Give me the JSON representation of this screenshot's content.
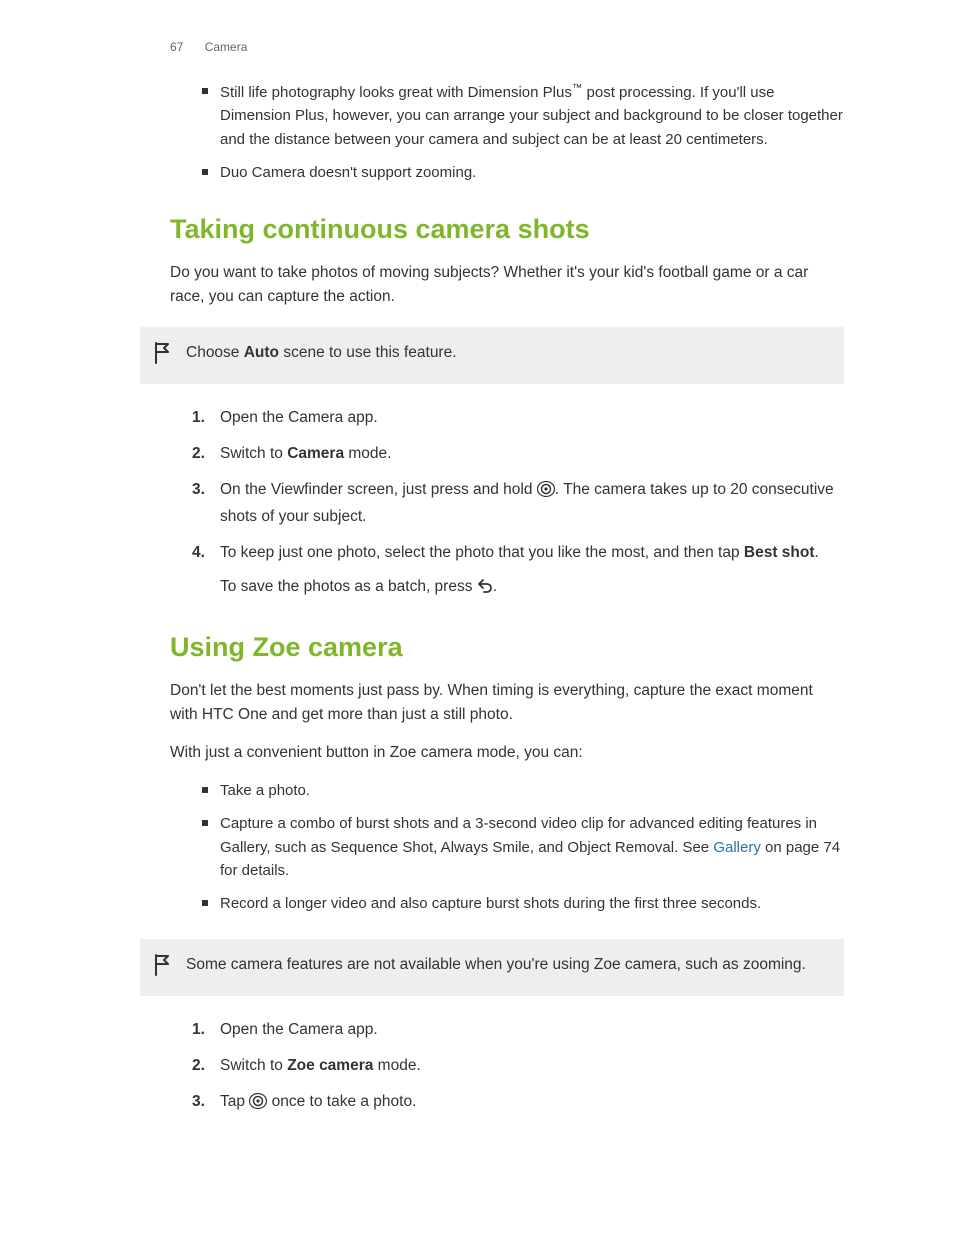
{
  "header": {
    "pageNumber": "67",
    "section": "Camera"
  },
  "intro_bullets": [
    {
      "pre": "Still life photography looks great with Dimension Plus",
      "tm": "™",
      "post": " post processing. If you'll use Dimension Plus, however, you can arrange your subject and background to be closer together and the distance between your camera and subject can be at least 20 centimeters."
    },
    {
      "text": "Duo Camera doesn't support zooming."
    }
  ],
  "section1": {
    "title": "Taking continuous camera shots",
    "intro": "Do you want to take photos of moving subjects? Whether it's your kid's football game or a car race, you can capture the action.",
    "note_pre": "Choose ",
    "note_bold": "Auto",
    "note_post": " scene to use this feature.",
    "steps": {
      "s1": "Open the Camera app.",
      "s2_pre": "Switch to ",
      "s2_bold": "Camera",
      "s2_post": " mode.",
      "s3_pre": "On the Viewfinder screen, just press and hold ",
      "s3_post": ". The camera takes up to 20 consecutive shots of your subject.",
      "s4_pre": "To keep just one photo, select the photo that you like the most, and then tap ",
      "s4_bold": "Best shot",
      "s4_post": ".",
      "s4_sub_pre": "To save the photos as a batch, press ",
      "s4_sub_post": "."
    }
  },
  "section2": {
    "title": "Using Zoe camera",
    "p1": "Don't let the best moments just pass by. When timing is everything, capture the exact moment with HTC One and get more than just a still photo.",
    "p2": "With just a convenient button in Zoe camera mode, you can:",
    "bullets": {
      "b1": "Take a photo.",
      "b2_pre": "Capture a combo of burst shots and a 3-second video clip for advanced editing features in Gallery, such as Sequence Shot, Always Smile, and Object Removal. See ",
      "b2_link": "Gallery",
      "b2_post": " on page 74 for details.",
      "b3": "Record a longer video and also capture burst shots during the first three seconds."
    },
    "note": "Some camera features are not available when you're using Zoe camera, such as zooming.",
    "steps": {
      "s1": "Open the Camera app.",
      "s2_pre": "Switch to ",
      "s2_bold": "Zoe camera",
      "s2_post": " mode.",
      "s3_pre": "Tap ",
      "s3_post": " once to take a photo."
    }
  }
}
